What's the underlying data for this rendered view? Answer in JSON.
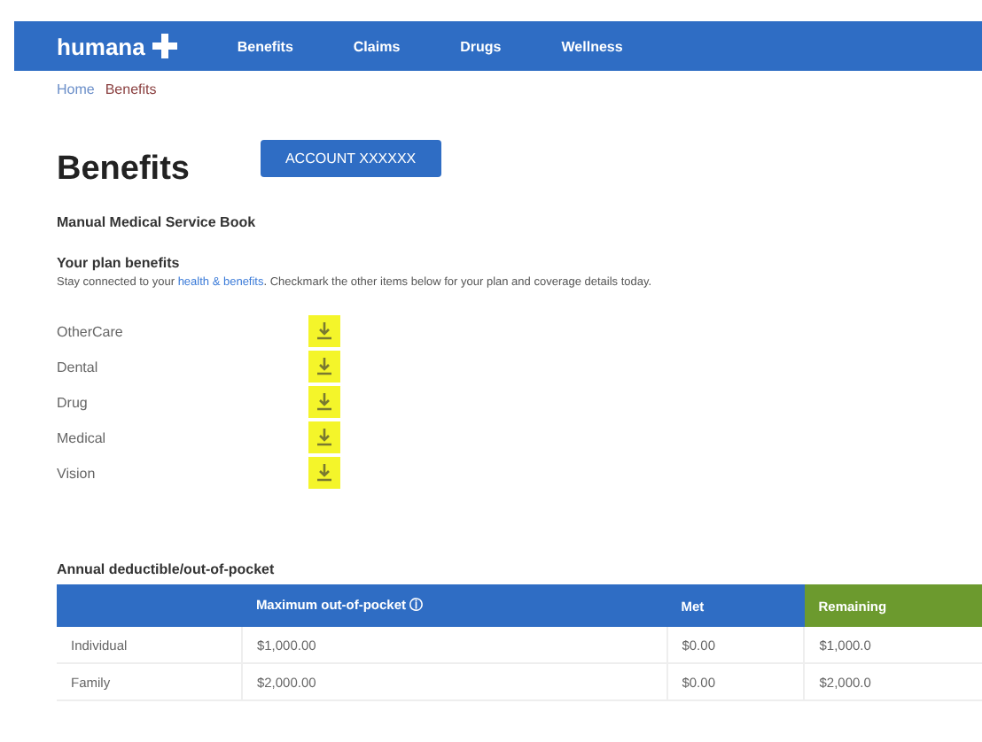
{
  "header": {
    "logo": "humana",
    "nav": [
      {
        "label": "Benefits",
        "selected": false
      },
      {
        "label": "Claims",
        "selected": false
      },
      {
        "label": "Drugs",
        "selected": false
      },
      {
        "label": "Wellness",
        "selected": false
      }
    ]
  },
  "breadcrumb": [
    "Home",
    "Benefits"
  ],
  "title": "Benefits",
  "account_button": "ACCOUNT XXXXXX",
  "subtitle": "Manual Medical Service Book",
  "plan": {
    "heading": "Your plan benefits",
    "text_before": "Stay connected to your",
    "link": "health & benefits",
    "text_after": ". Checkmark the other items below for your plan and coverage details today."
  },
  "documents": [
    {
      "label": "OtherCare",
      "highlighted": true
    },
    {
      "label": "Dental",
      "highlighted": true
    },
    {
      "label": "Drug",
      "highlighted": true
    },
    {
      "label": "Medical",
      "highlighted": true
    },
    {
      "label": "Vision",
      "highlighted": true
    }
  ],
  "table": {
    "title": "Annual deductible/out-of-pocket",
    "columns": [
      "",
      "Maximum out-of-pocket ⓘ",
      "Met",
      "Remaining"
    ],
    "rows": [
      [
        "Individual",
        "$1,000.00",
        "$0.00",
        "$1,000.0"
      ],
      [
        "Family",
        "$2,000.00",
        "$0.00",
        "$2,000.0"
      ]
    ]
  }
}
